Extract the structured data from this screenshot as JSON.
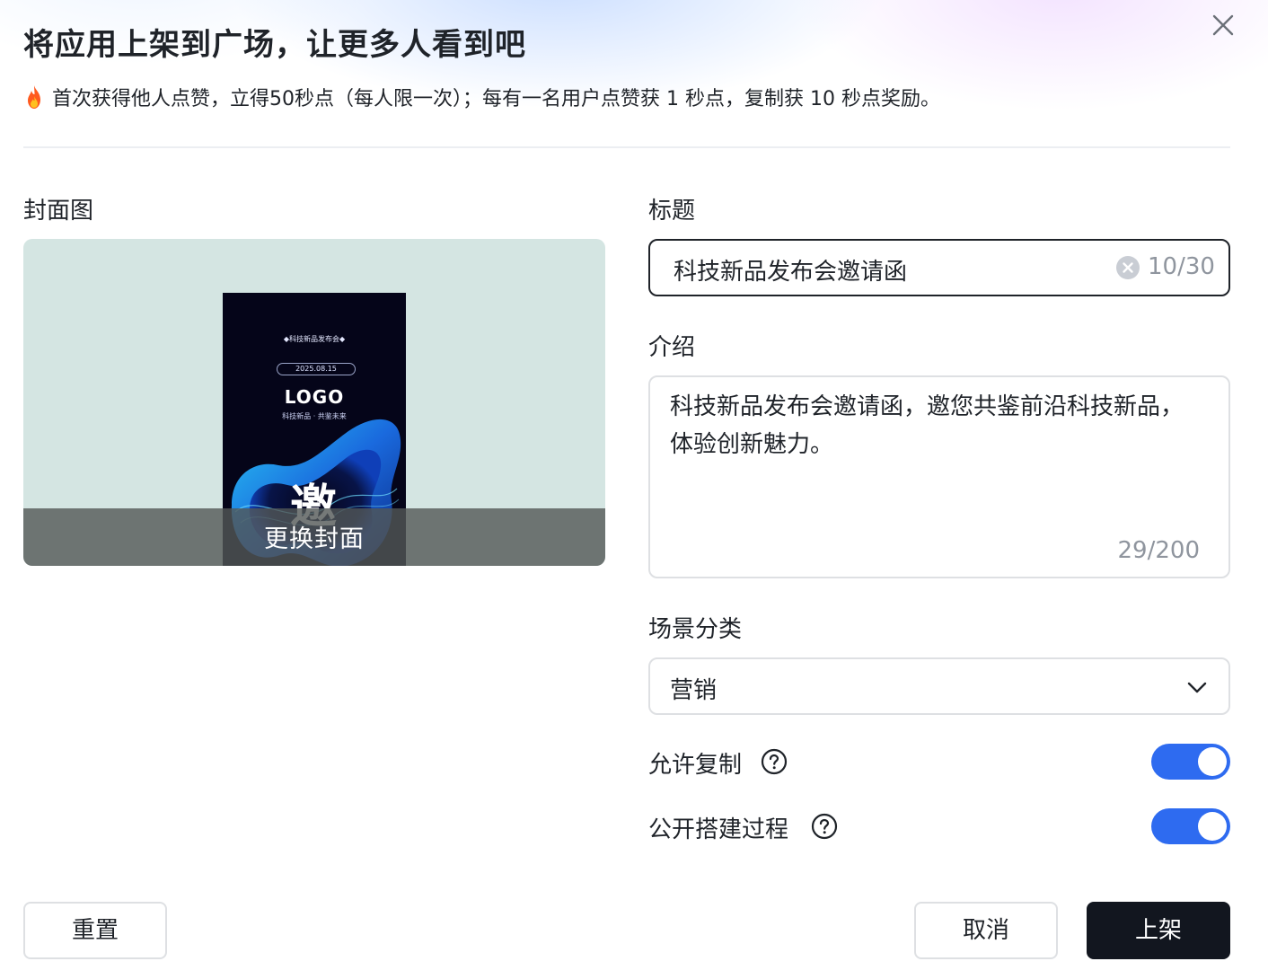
{
  "dialog": {
    "title": "将应用上架到广场，让更多人看到吧",
    "notice": "首次获得他人点赞，立得50秒点（每人限一次）；每有一名用户点赞获 1 秒点，复制获 10 秒点奖励。"
  },
  "cover": {
    "label": "封面图",
    "change_label": "更换封面",
    "poster": {
      "heading": "◆科技新品发布会◆",
      "date": "2025.08.15",
      "logo": "LOGO",
      "tagline": "科技新品 · 共鉴未来",
      "character": "邀"
    }
  },
  "form": {
    "title_label": "标题",
    "title_value": "科技新品发布会邀请函",
    "title_count": "10/30",
    "intro_label": "介绍",
    "intro_value": "科技新品发布会邀请函，邀您共鉴前沿科技新品，体验创新魅力。",
    "intro_count": "29/200",
    "category_label": "场景分类",
    "category_value": "营销",
    "allow_copy_label": "允许复制",
    "allow_copy_on": true,
    "public_process_label": "公开搭建过程",
    "public_process_on": true
  },
  "footer": {
    "reset_label": "重置",
    "cancel_label": "取消",
    "publish_label": "上架"
  },
  "colors": {
    "accent": "#2e6bf0",
    "primary_button": "#12161f",
    "cover_background": "#d4e5e2"
  },
  "icons": [
    "close-icon",
    "fire-icon",
    "clear-icon",
    "chevron-down-icon",
    "help-icon"
  ]
}
